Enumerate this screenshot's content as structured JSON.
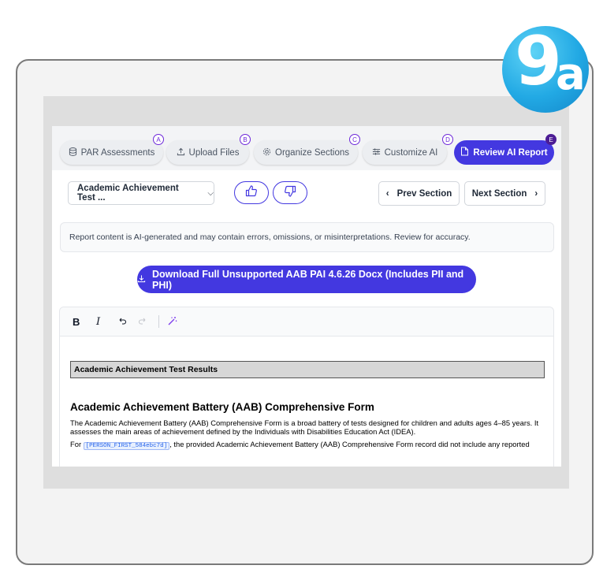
{
  "badge": {
    "number": "9",
    "letter": "a"
  },
  "steps": [
    {
      "label": "PAR Assessments",
      "marker": "A",
      "icon": "database-icon"
    },
    {
      "label": "Upload Files",
      "marker": "B",
      "icon": "upload-icon"
    },
    {
      "label": "Organize Sections",
      "marker": "C",
      "icon": "gear-icon"
    },
    {
      "label": "Customize AI",
      "marker": "D",
      "icon": "sliders-icon"
    },
    {
      "label": "Review AI Report",
      "marker": "E",
      "icon": "document-icon",
      "active": true
    }
  ],
  "toolbar": {
    "section_select": "Academic Achievement Test ...",
    "prev_label": "Prev Section",
    "next_label": "Next Section"
  },
  "notice": "Report content is AI-generated and may contain errors, omissions, or misinterpretations. Review for accuracy.",
  "download_label": "Download Full Unsupported AAB PAI 4.6.26 Docx (Includes PII and PHI)",
  "editor": {
    "bold": "B",
    "italic": "I",
    "section_header": "Academic Achievement Test Results",
    "title": "Academic Achievement Battery (AAB) Comprehensive Form",
    "paragraph": "The Academic Achievement Battery (AAB) Comprehensive Form is a broad battery of tests designed for children and adults ages 4–85 years. It assesses the main areas of achievement defined by the Individuals with Disabilities Education Act (IDEA).",
    "para2_prefix": "For",
    "token": "[PERSON_FIRST_584ebc7d]",
    "para2_suffix": ", the provided Academic Achievement Battery (AAB) Comprehensive Form record did not include any reported"
  },
  "colors": {
    "accent": "#4338e0",
    "marker": "#6d28d9",
    "badge": "#22a9e4"
  }
}
